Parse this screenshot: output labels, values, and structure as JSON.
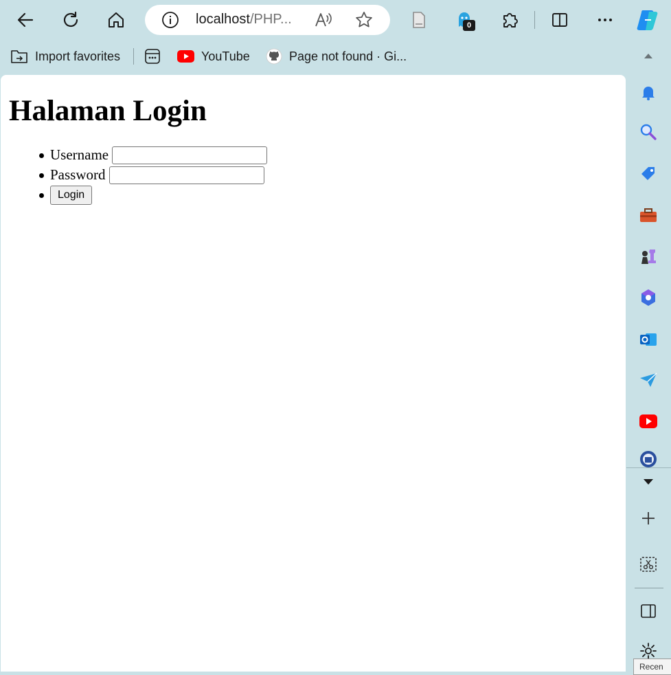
{
  "browser": {
    "address": {
      "host": "localhost",
      "path": "/PHP..."
    },
    "extension_badge": "0"
  },
  "favorites": [
    {
      "label": "Import favorites",
      "icon": "import-favorites-icon"
    },
    {
      "label": "",
      "icon": "app-grid-icon"
    },
    {
      "label": "YouTube",
      "icon": "youtube-icon"
    },
    {
      "label": "Page not found · Gi...",
      "icon": "github-icon"
    }
  ],
  "page": {
    "title": "Halaman Login",
    "username_label": "Username",
    "username_value": "",
    "password_label": "Password",
    "password_value": "",
    "login_label": "Login"
  },
  "sidebar": {
    "tooltip": "Recen"
  },
  "colors": {
    "chrome_bg": "#c9e1e6",
    "page_bg": "#ffffff",
    "youtube_red": "#ff0000"
  }
}
